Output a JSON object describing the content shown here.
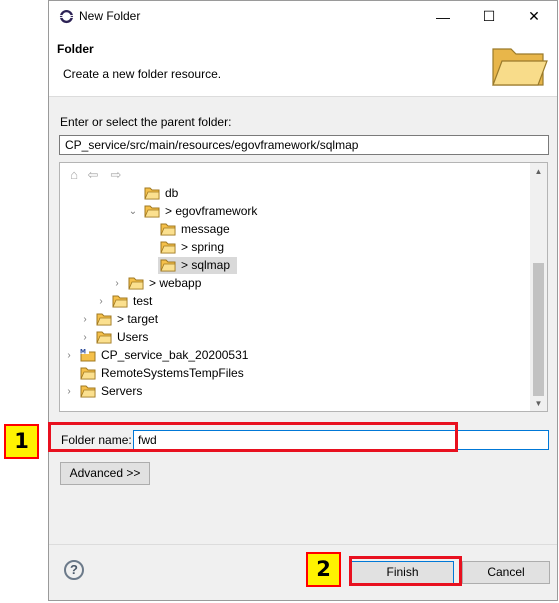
{
  "window": {
    "title": "New Folder",
    "minimize": "—",
    "maximize": "☐",
    "close": "✕"
  },
  "header": {
    "title": "Folder",
    "description": "Create a new folder resource."
  },
  "parent": {
    "label": "Enter or select the parent folder:",
    "value": "CP_service/src/main/resources/egovframework/sqlmap"
  },
  "tree": {
    "items": [
      {
        "label": "db"
      },
      {
        "label": "> egovframework"
      },
      {
        "label": "message"
      },
      {
        "label": "> spring"
      },
      {
        "label": "> sqlmap"
      },
      {
        "label": "> webapp"
      },
      {
        "label": "test"
      },
      {
        "label": "> target"
      },
      {
        "label": "Users"
      },
      {
        "label": "CP_service_bak_20200531"
      },
      {
        "label": "RemoteSystemsTempFiles"
      },
      {
        "label": "Servers"
      }
    ]
  },
  "folder_name": {
    "label": "Folder name:",
    "value": "fwd"
  },
  "buttons": {
    "advanced": "Advanced >>",
    "finish": "Finish",
    "cancel": "Cancel",
    "help": "?"
  },
  "annotations": {
    "step1": "1",
    "step2": "2"
  },
  "colors": {
    "highlight": "#e8101f",
    "badge_fill": "#fff200",
    "folder": "#f5c04a"
  }
}
